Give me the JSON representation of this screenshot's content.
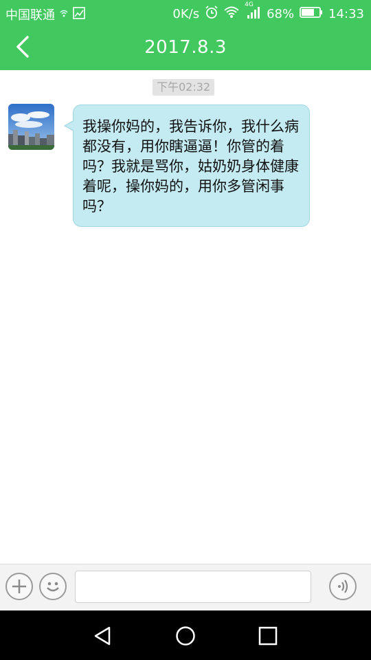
{
  "status_bar": {
    "carrier": "中国联通",
    "network_speed": "0K/s",
    "network_type": "4G",
    "battery": "68%",
    "time": "14:33"
  },
  "header": {
    "title": "2017.8.3"
  },
  "chat": {
    "timestamp": "下午02:32",
    "messages": [
      {
        "sender": "other",
        "text": "我操你妈的，我告诉你，我什么病都没有，用你瞎逼逼！你管的着吗？我就是骂你，姑奶奶身体健康着呢，操你妈的，用你多管闲事吗？"
      }
    ]
  },
  "input_bar": {
    "value": "",
    "placeholder": ""
  },
  "colors": {
    "header_green": "#41c85f",
    "bubble_bg": "#c4eaf2",
    "bubble_border": "#9fd6e3"
  }
}
